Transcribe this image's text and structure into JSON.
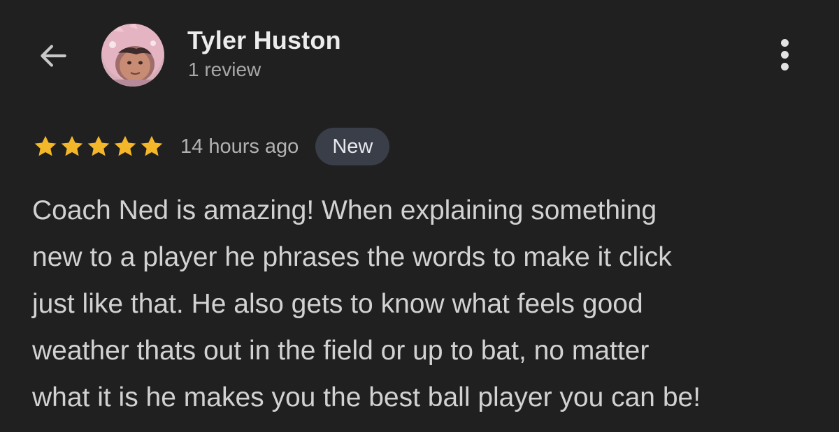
{
  "header": {
    "reviewer_name": "Tyler Huston",
    "review_count": "1 review"
  },
  "icons": {
    "back": "arrow-left-icon",
    "more": "more-vertical-icon",
    "star": "star-icon"
  },
  "review": {
    "rating": 5,
    "rating_max": 5,
    "time_ago": "14 hours ago",
    "badge": "New",
    "lines": [
      "Coach Ned is amazing! When explaining something",
      "new to a player he phrases the words to make it click",
      "just like that. He also gets to know what feels good",
      "weather thats out in the field or up to bat, no matter",
      "what it is he makes you the best ball player you can be!"
    ]
  },
  "colors": {
    "background": "#202020",
    "star": "#f5b72a",
    "badge_bg": "#3a3e48",
    "text_primary": "#ececec",
    "text_secondary": "#a8a8a8"
  }
}
